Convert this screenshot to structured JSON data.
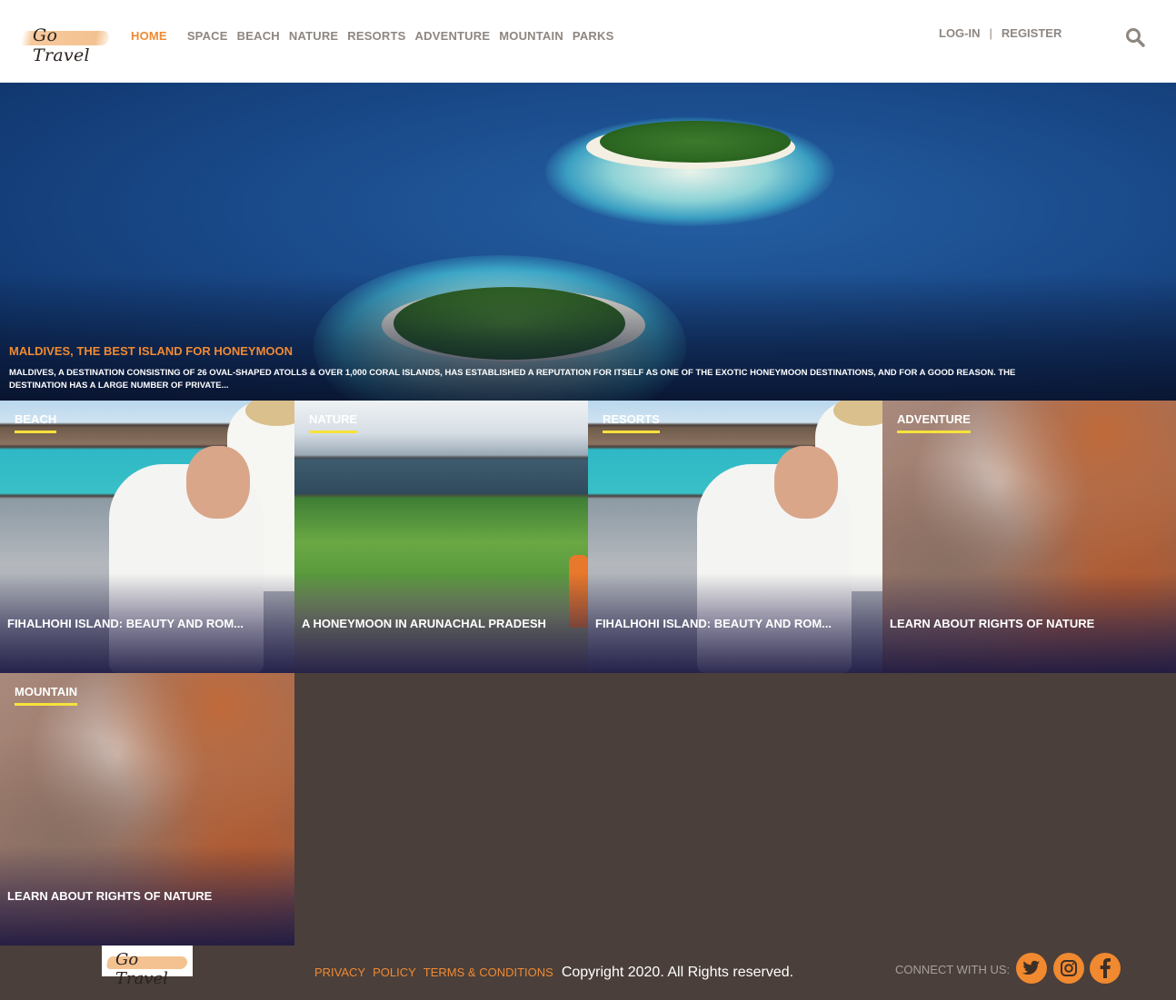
{
  "brand": {
    "logo_text": "Go Travel"
  },
  "nav": {
    "items": [
      {
        "label": "HOME",
        "active": true
      },
      {
        "label": "SPACE",
        "active": false
      },
      {
        "label": "BEACH",
        "active": false
      },
      {
        "label": "NATURE",
        "active": false
      },
      {
        "label": "RESORTS",
        "active": false
      },
      {
        "label": "ADVENTURE",
        "active": false
      },
      {
        "label": "MOUNTAIN",
        "active": false
      },
      {
        "label": "PARKS",
        "active": false
      }
    ]
  },
  "auth": {
    "login": "LOG-IN",
    "separator": "|",
    "register": "REGISTER"
  },
  "search": {
    "icon": "search-icon"
  },
  "hero": {
    "title": "MALDIVES, THE BEST ISLAND FOR HONEYMOON",
    "description": "MALDIVES, A DESTINATION CONSISTING OF 26 OVAL-SHAPED ATOLLS & OVER 1,000 CORAL ISLANDS, HAS ESTABLISHED A REPUTATION FOR ITSELF AS ONE OF THE EXOTIC HONEYMOON DESTINATIONS, AND FOR A GOOD REASON. THE DESTINATION HAS A LARGE NUMBER OF PRIVATE..."
  },
  "cards": [
    {
      "category": "BEACH",
      "title": "FIHALHOHI ISLAND: BEAUTY AND ROM..."
    },
    {
      "category": "NATURE",
      "title": "A HONEYMOON IN ARUNACHAL PRADESH"
    },
    {
      "category": "RESORTS",
      "title": "FIHALHOHI ISLAND: BEAUTY AND ROM..."
    },
    {
      "category": "ADVENTURE",
      "title": "LEARN ABOUT RIGHTS OF NATURE"
    },
    {
      "category": "MOUNTAIN",
      "title": "LEARN ABOUT RIGHTS OF NATURE"
    }
  ],
  "footer": {
    "logo_text": "Go Travel",
    "links": [
      "PRIVACY",
      "POLICY",
      "TERMS & CONDITIONS"
    ],
    "copyright": "Copyright 2020. All Rights reserved.",
    "connect_label": "CONNECT WITH US:",
    "social": [
      "twitter-icon",
      "instagram-icon",
      "facebook-icon"
    ]
  },
  "colors": {
    "accent": "#f08a33",
    "underline": "#f7e23b",
    "footer_bg": "#4a3f3a",
    "nav_text": "#8e8781"
  }
}
